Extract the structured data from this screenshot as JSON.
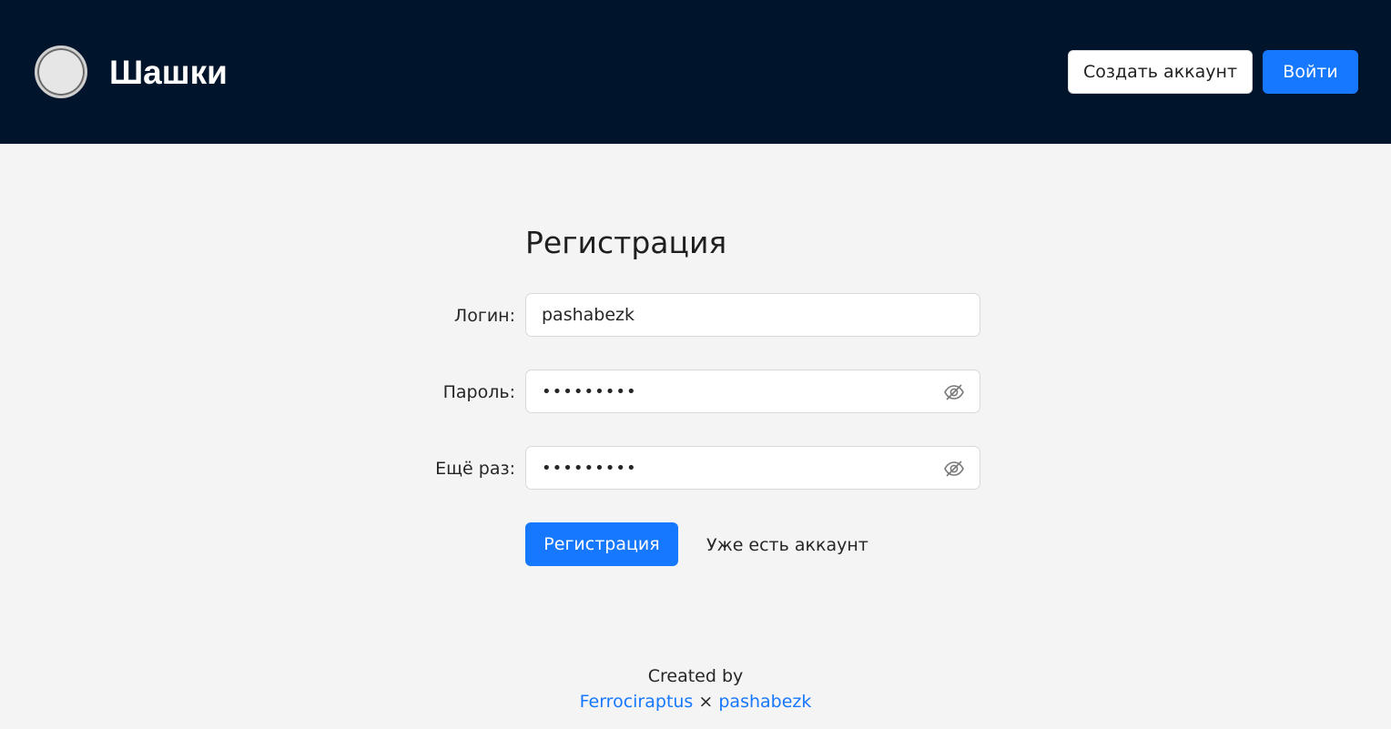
{
  "header": {
    "brand": "Шашки",
    "create_account_label": "Создать аккаунт",
    "login_label": "Войти"
  },
  "form": {
    "title": "Регистрация",
    "login": {
      "label": "Логин",
      "value": "pashabezk"
    },
    "password": {
      "label": "Пароль",
      "value": "•••••••••"
    },
    "repeat": {
      "label": "Ещё раз",
      "value": "•••••••••"
    },
    "submit_label": "Регистрация",
    "have_account_label": "Уже есть аккаунт"
  },
  "footer": {
    "created_by": "Created by",
    "author1": "Ferrociraptus",
    "separator": "×",
    "author2": "pashabezk"
  },
  "colors": {
    "header_bg": "#00152b",
    "accent": "#1677ff",
    "page_bg": "#f4f4f4"
  },
  "icons": {
    "logo": "checker-piece-icon",
    "password_toggle": "eye-invisible-icon"
  }
}
